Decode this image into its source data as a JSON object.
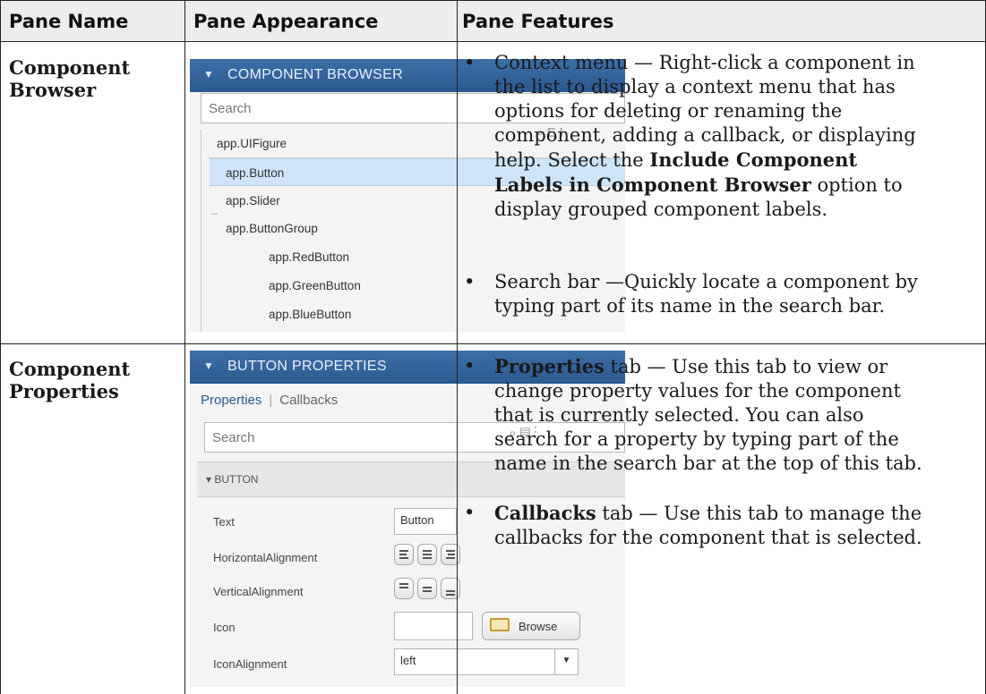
{
  "header": {
    "col1": "Pane Name",
    "col2": "Pane Appearance",
    "col3": "Pane Features"
  },
  "rows": [
    {
      "name_line1": "Component",
      "name_line2": "Browser",
      "image": {
        "title": "COMPONENT BROWSER",
        "search_placeholder": "Search",
        "tree": [
          "app.UIFigure",
          "app.Button",
          "app.Slider",
          "app.ButtonGroup",
          "app.RedButton",
          "app.GreenButton",
          "app.BlueButton"
        ],
        "selected": "app.Button"
      },
      "features": [
        {
          "lines": [
            "Context menu — Right-click a component in",
            "the list to display a context menu that has",
            "options for deleting or renaming the",
            "component, adding a callback, or displaying",
            "help. Select the ",
            "Include Component",
            "Labels in Component Browser",
            " option to",
            "display grouped component labels."
          ]
        },
        {
          "lines": [
            "Search bar —Quickly locate a component by",
            "typing part of its name in the search bar."
          ]
        }
      ]
    },
    {
      "name_line1": "Component",
      "name_line2": "Properties",
      "image": {
        "title": "BUTTON PROPERTIES",
        "tab_properties": "Properties",
        "tab_separator": "|",
        "tab_callbacks": "Callbacks",
        "search_placeholder": "Search",
        "section": "BUTTON",
        "labels": [
          "Text",
          "HorizontalAlignment",
          "VerticalAlignment",
          "Icon",
          "IconAlignment"
        ],
        "text_value": "Button",
        "browse_label": "Browse",
        "icon_alignment_value": "left"
      },
      "features": [
        {
          "bold": "Properties",
          "lines": [
            " tab — Use this tab to view or",
            "change property values for the component",
            "that is currently selected. You can also",
            "search for a property by typing part of the",
            "name in the search bar at the top of this tab."
          ]
        },
        {
          "bold": "Callbacks",
          "lines": [
            " tab — Use this tab to manage the",
            "callbacks for the component that is selected."
          ]
        }
      ]
    }
  ],
  "bullet_char": "•"
}
